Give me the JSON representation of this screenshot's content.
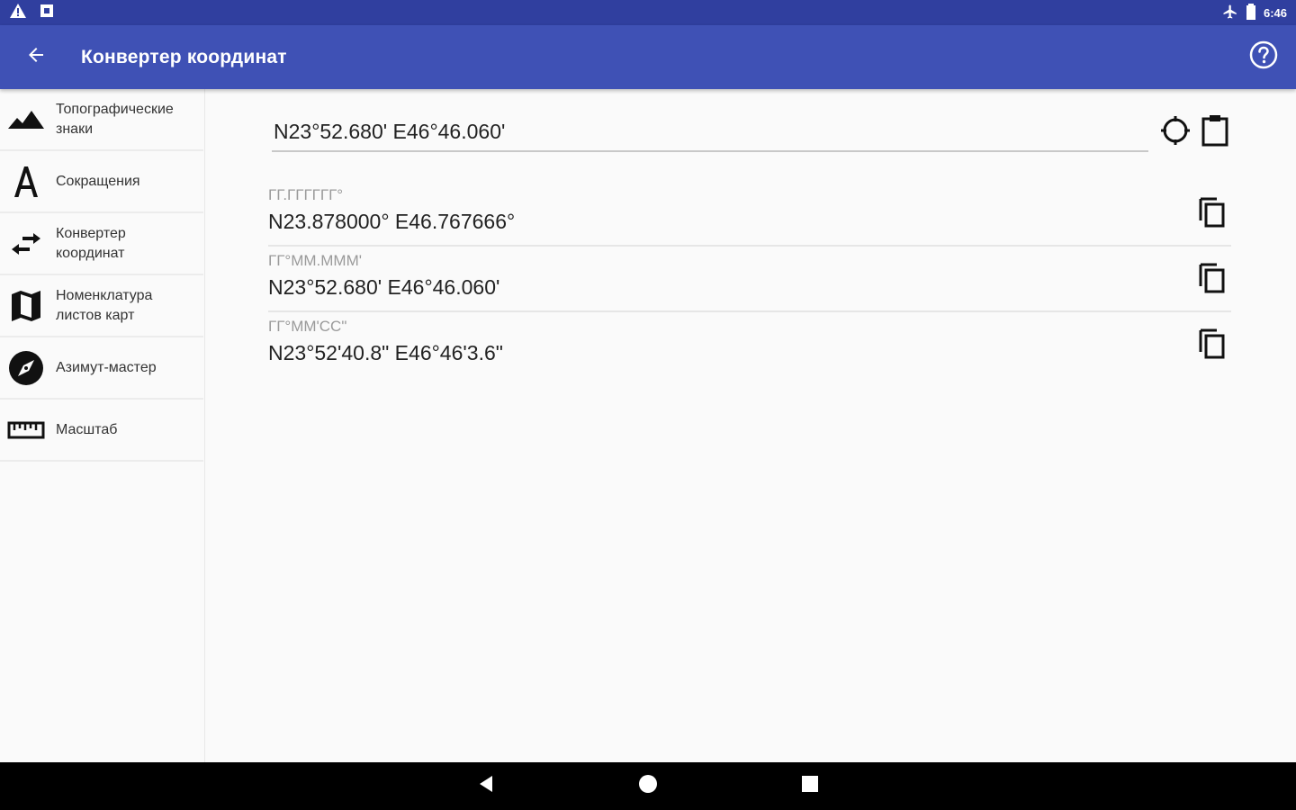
{
  "status_bar": {
    "time": "6:46",
    "icons": [
      "warning-icon",
      "notification-square-icon",
      "airplane-icon",
      "battery-icon"
    ]
  },
  "app_bar": {
    "title": "Конвертер координат",
    "back_icon": "arrow-back-icon",
    "help_icon": "help-circle-icon",
    "color": "#3f51b5",
    "status_color": "#303f9f"
  },
  "sidebar": {
    "items": [
      {
        "label": "Топографические\nзнаки",
        "icon": "mountain-icon"
      },
      {
        "label": "Сокращения",
        "icon": "letter-a-icon"
      },
      {
        "label": "Конвертер\nкоординат",
        "icon": "swap-arrows-icon"
      },
      {
        "label": "Номенклатура\nлистов карт",
        "icon": "map-icon"
      },
      {
        "label": "Азимут-мастер",
        "icon": "compass-icon"
      },
      {
        "label": "Масштаб",
        "icon": "ruler-icon"
      }
    ]
  },
  "main": {
    "input_value": "N23°52.680' E46°46.060'",
    "locate_icon": "crosshair-icon",
    "paste_icon": "clipboard-icon",
    "results": [
      {
        "format": "ГГ.ГГГГГГ°",
        "value": "N23.878000° E46.767666°",
        "icon": "copy-icon"
      },
      {
        "format": "ГГ°ММ.МММ'",
        "value": "N23°52.680' E46°46.060'",
        "icon": "copy-icon"
      },
      {
        "format": "ГГ°ММ'СС\"",
        "value": "N23°52'40.8\" E46°46'3.6\"",
        "icon": "copy-icon"
      }
    ]
  },
  "nav_bar": {
    "icons": [
      "back-triangle-icon",
      "home-circle-icon",
      "recents-square-icon"
    ]
  }
}
